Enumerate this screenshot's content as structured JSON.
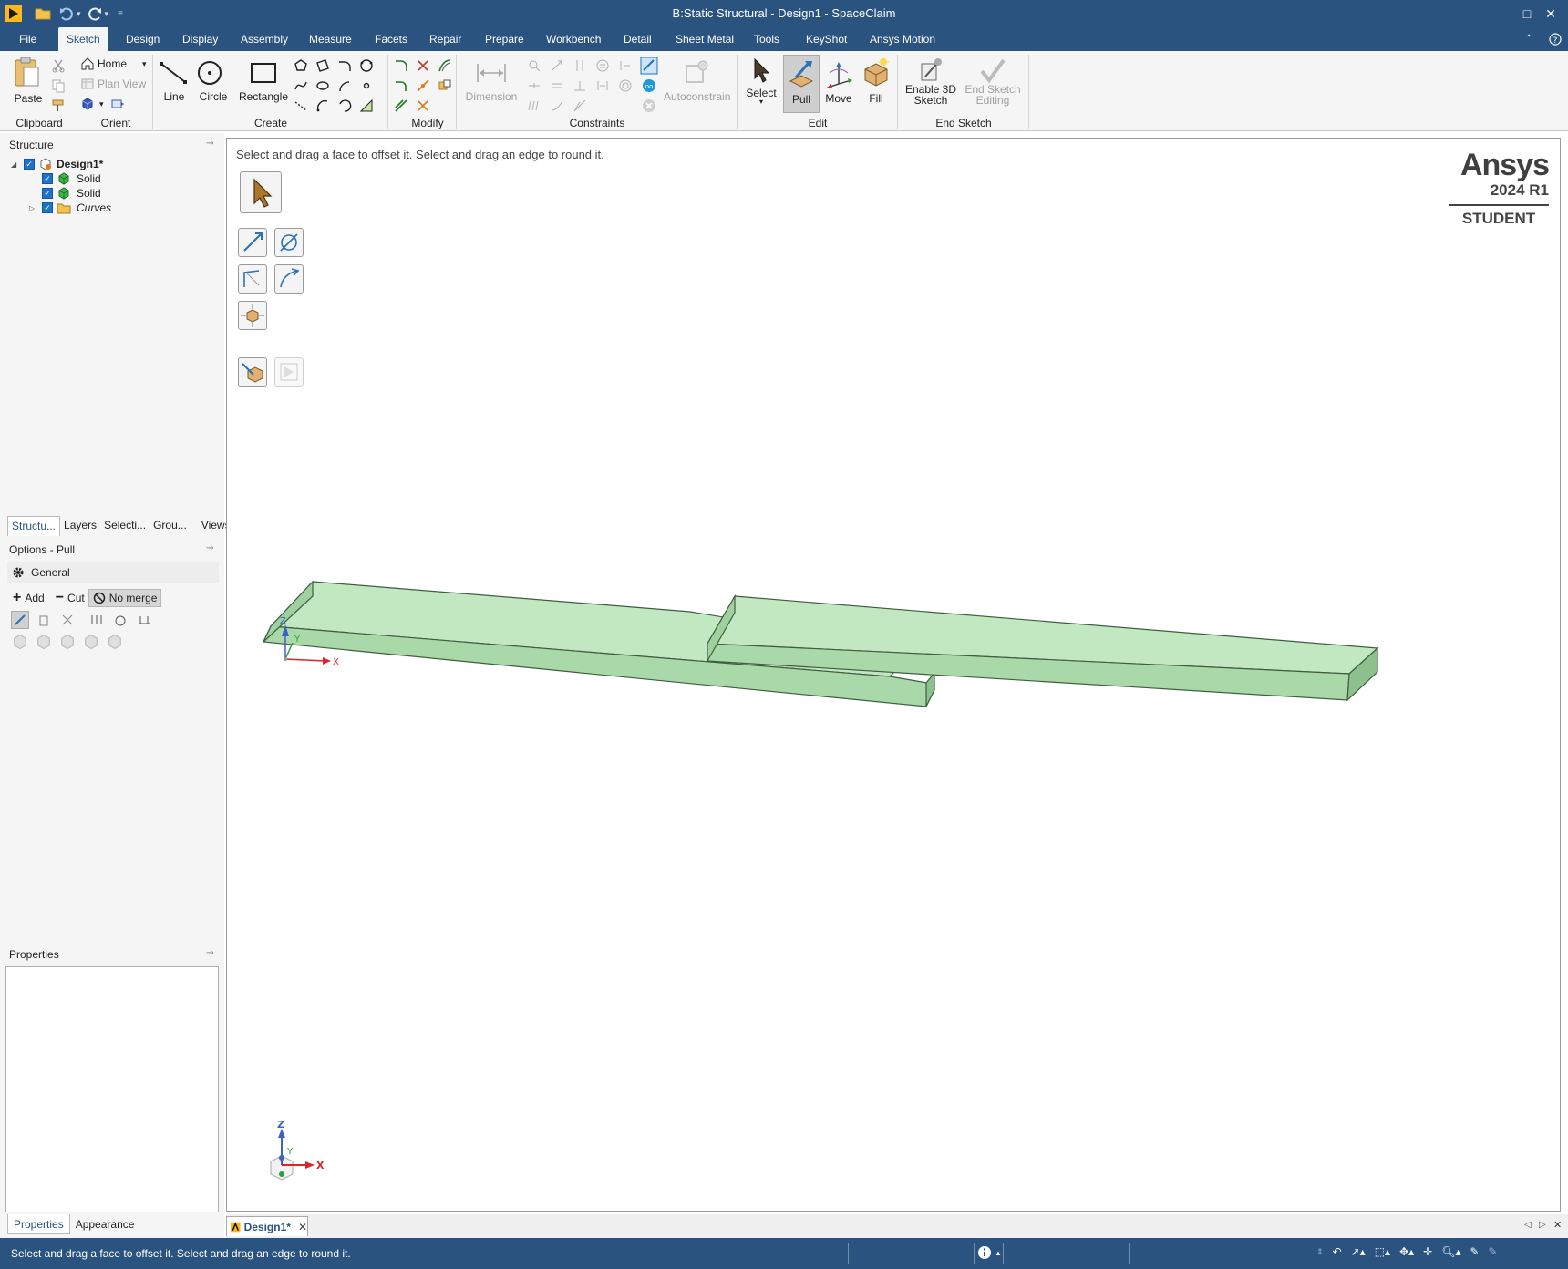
{
  "window": {
    "title": "B:Static Structural - Design1 - SpaceClaim",
    "controls": {
      "minimize": "–",
      "maximize": "□",
      "close": "✕"
    }
  },
  "menu": {
    "tabs": [
      "File",
      "Sketch",
      "Design",
      "Display",
      "Assembly",
      "Measure",
      "Facets",
      "Repair",
      "Prepare",
      "Workbench",
      "Detail",
      "Sheet Metal",
      "Tools",
      "KeyShot",
      "Ansys Motion"
    ],
    "active": "Sketch"
  },
  "ribbon": {
    "clipboard": {
      "label": "Clipboard",
      "paste": "Paste"
    },
    "orient": {
      "label": "Orient",
      "home": "Home",
      "plan_view": "Plan View"
    },
    "create": {
      "label": "Create",
      "line": "Line",
      "circle": "Circle",
      "rectangle": "Rectangle"
    },
    "modify": {
      "label": "Modify"
    },
    "constraints": {
      "label": "Constraints",
      "dimension": "Dimension",
      "autoconstrain": "Autoconstrain"
    },
    "edit": {
      "label": "Edit",
      "select": "Select",
      "pull": "Pull",
      "move": "Move",
      "fill": "Fill"
    },
    "end_sketch": {
      "label": "End Sketch",
      "enable3d_1": "Enable 3D",
      "enable3d_2": "Sketch",
      "end_edit_1": "End Sketch",
      "end_edit_2": "Editing"
    }
  },
  "structure": {
    "header": "Structure",
    "items": [
      {
        "label": "Design1*",
        "bold": true
      },
      {
        "label": "Solid"
      },
      {
        "label": "Solid"
      },
      {
        "label": "Curves",
        "italic": true
      }
    ]
  },
  "pane_tabs": [
    "Structu...",
    "Layers",
    "Selecti...",
    "Grou...",
    "Views"
  ],
  "options": {
    "header": "Options - Pull",
    "general": "General",
    "add": "Add",
    "cut": "Cut",
    "no_merge": "No merge"
  },
  "properties": {
    "header": "Properties",
    "tabs": [
      "Properties",
      "Appearance"
    ]
  },
  "viewport": {
    "hint": "Select and drag a face to offset it. Select and drag an edge to round it.",
    "brand": {
      "name": "Ansys",
      "version": "2024 R1",
      "edition": "STUDENT"
    },
    "triad_labels": {
      "x": "X",
      "y": "Y",
      "z": "Z"
    },
    "colors": {
      "solid_top": "#c2e8c2",
      "solid_side": "#a9d8a9",
      "solid_edge": "#3f5e3f"
    }
  },
  "document_tab": {
    "label": "Design1*"
  },
  "status": {
    "message": "Select and drag a face to offset it. Select and drag an edge to round it."
  },
  "colors": {
    "titlebar": "#2a5380",
    "ribbon": "#f5f5f5",
    "accent": "#1e73c8"
  }
}
